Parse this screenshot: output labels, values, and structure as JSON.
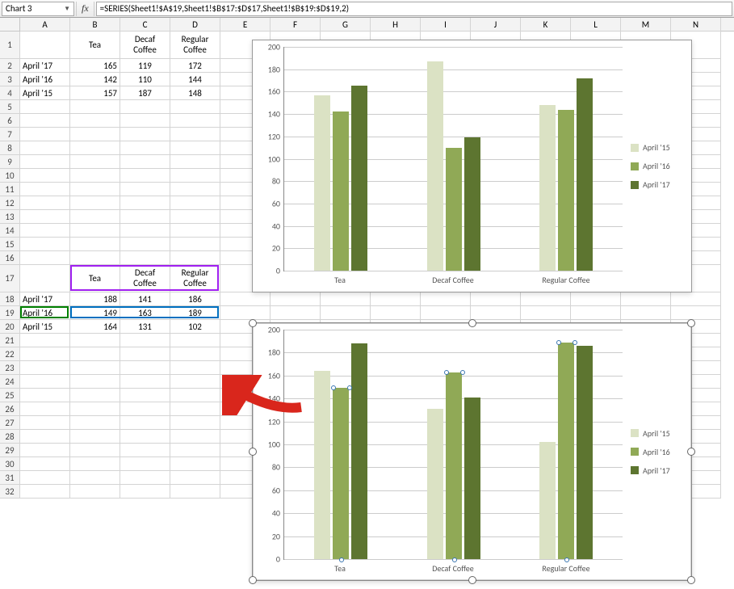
{
  "name_box": "Chart 3",
  "fx_label": "fx",
  "formula": "=SERIES(Sheet1!$A$19,Sheet1!$B$17:$D$17,Sheet1!$B$19:$D$19,2)",
  "columns": [
    "A",
    "B",
    "C",
    "D",
    "E",
    "F",
    "G",
    "H",
    "I",
    "J",
    "K",
    "L",
    "M",
    "N"
  ],
  "table1": {
    "headers": [
      "",
      "Tea",
      "Decaf Coffee",
      "Regular Coffee"
    ],
    "rows": [
      {
        "label": "April '17",
        "vals": [
          165,
          119,
          172
        ]
      },
      {
        "label": "April '16",
        "vals": [
          142,
          110,
          144
        ]
      },
      {
        "label": "April '15",
        "vals": [
          157,
          187,
          148
        ]
      }
    ]
  },
  "table2": {
    "headers": [
      "",
      "Tea",
      "Decaf Coffee",
      "Regular Coffee"
    ],
    "rows": [
      {
        "label": "April '17",
        "vals": [
          188,
          141,
          186
        ]
      },
      {
        "label": "April '16",
        "vals": [
          149,
          163,
          189
        ]
      },
      {
        "label": "April '15",
        "vals": [
          164,
          131,
          102
        ]
      }
    ]
  },
  "chart_data": [
    {
      "type": "bar",
      "categories": [
        "Tea",
        "Decaf Coffee",
        "Regular Coffee"
      ],
      "series": [
        {
          "name": "April '15",
          "values": [
            157,
            187,
            148
          ]
        },
        {
          "name": "April '16",
          "values": [
            142,
            110,
            144
          ]
        },
        {
          "name": "April '17",
          "values": [
            165,
            119,
            172
          ]
        }
      ],
      "ylim": [
        0,
        200
      ],
      "yticks": [
        0,
        20,
        40,
        60,
        80,
        100,
        120,
        140,
        160,
        180,
        200
      ],
      "legend_names": [
        "April '15",
        "April '16",
        "April '17"
      ]
    },
    {
      "type": "bar",
      "categories": [
        "Tea",
        "Decaf Coffee",
        "Regular Coffee"
      ],
      "series": [
        {
          "name": "April '15",
          "values": [
            164,
            131,
            102
          ]
        },
        {
          "name": "April '16",
          "values": [
            149,
            163,
            189
          ]
        },
        {
          "name": "April '17",
          "values": [
            188,
            141,
            186
          ]
        }
      ],
      "ylim": [
        0,
        200
      ],
      "yticks": [
        0,
        20,
        40,
        60,
        80,
        100,
        120,
        140,
        160,
        180,
        200
      ],
      "legend_names": [
        "April '15",
        "April '16",
        "April '17"
      ]
    }
  ]
}
